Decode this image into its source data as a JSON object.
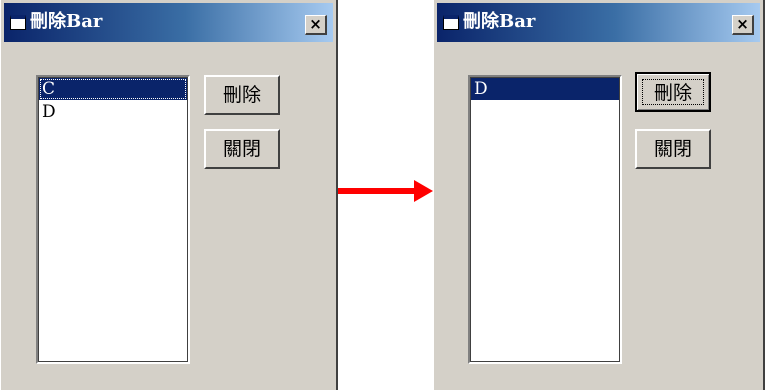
{
  "before": {
    "title": "刪除Bar",
    "close_glyph": "×",
    "list_items": [
      "C",
      "D"
    ],
    "selected_item": "C",
    "delete_button": "刪除",
    "close_button": "關閉"
  },
  "after": {
    "title": "刪除Bar",
    "close_glyph": "×",
    "list_items": [
      "D"
    ],
    "selected_item": "D",
    "delete_button": "刪除",
    "close_button": "關閉"
  },
  "arrow": {
    "color": "#ff0000",
    "icon": "right-arrow-icon"
  },
  "colors": {
    "titlebar": "#0a246a",
    "selection": "#0a246a",
    "window": "#d4d0c8"
  }
}
